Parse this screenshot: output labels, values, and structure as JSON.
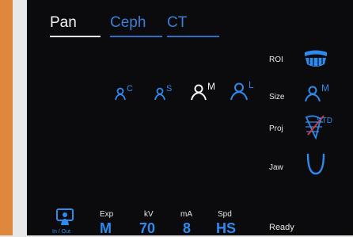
{
  "tabs": [
    {
      "label": "Pan",
      "active": true
    },
    {
      "label": "Ceph",
      "active": false
    },
    {
      "label": "CT",
      "active": false
    }
  ],
  "jaw_sizes": [
    {
      "letter": "C",
      "selected": false
    },
    {
      "letter": "S",
      "selected": false
    },
    {
      "letter": "M",
      "selected": true
    },
    {
      "letter": "L",
      "selected": false
    }
  ],
  "side_panel": {
    "roi_label": "ROI",
    "size_label": "Size",
    "size_value": "M",
    "proj_label": "Proj",
    "proj_value": "STD",
    "jaw_label": "Jaw"
  },
  "bottom": {
    "inout_label": "In / Out",
    "exp_label": "Exp",
    "exp_value": "M",
    "kv_label": "kV",
    "kv_value": "70",
    "ma_label": "mA",
    "ma_value": "8",
    "spd_label": "Spd",
    "spd_value": "HS",
    "status": "Ready"
  },
  "colors": {
    "accent": "#2d8bf0",
    "tab_inactive": "#3a7fd6",
    "active_white": "#f4f4f4",
    "background": "#0b0b0d",
    "bezel": "#e0873e"
  }
}
